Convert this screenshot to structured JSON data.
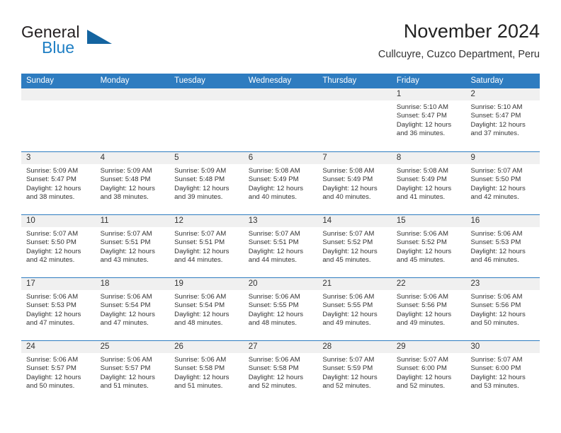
{
  "brand": {
    "word_one": "General",
    "word_two": "Blue",
    "triangle_icon": "brand-triangle-icon",
    "accent_dark": "#1464a0",
    "accent_blue": "#1f7fc4"
  },
  "header": {
    "title": "November 2024",
    "subtitle": "Cullcuyre, Cuzco Department, Peru"
  },
  "theme": {
    "header_row_bg": "#2e7cc0",
    "day_number_bg": "#f0f0f0",
    "row_divider": "#2e7cc0",
    "text": "#333333"
  },
  "weekdays": [
    "Sunday",
    "Monday",
    "Tuesday",
    "Wednesday",
    "Thursday",
    "Friday",
    "Saturday"
  ],
  "labels": {
    "sunrise": "Sunrise:",
    "sunset": "Sunset:",
    "daylight": "Daylight:"
  },
  "weeks": [
    [
      {
        "day": "",
        "sunrise": "",
        "sunset": "",
        "daylight": "",
        "empty": true
      },
      {
        "day": "",
        "sunrise": "",
        "sunset": "",
        "daylight": "",
        "empty": true
      },
      {
        "day": "",
        "sunrise": "",
        "sunset": "",
        "daylight": "",
        "empty": true
      },
      {
        "day": "",
        "sunrise": "",
        "sunset": "",
        "daylight": "",
        "empty": true
      },
      {
        "day": "",
        "sunrise": "",
        "sunset": "",
        "daylight": "",
        "empty": true
      },
      {
        "day": "1",
        "sunrise": "Sunrise: 5:10 AM",
        "sunset": "Sunset: 5:47 PM",
        "daylight": "Daylight: 12 hours and 36 minutes.",
        "empty": false
      },
      {
        "day": "2",
        "sunrise": "Sunrise: 5:10 AM",
        "sunset": "Sunset: 5:47 PM",
        "daylight": "Daylight: 12 hours and 37 minutes.",
        "empty": false
      }
    ],
    [
      {
        "day": "3",
        "sunrise": "Sunrise: 5:09 AM",
        "sunset": "Sunset: 5:47 PM",
        "daylight": "Daylight: 12 hours and 38 minutes.",
        "empty": false
      },
      {
        "day": "4",
        "sunrise": "Sunrise: 5:09 AM",
        "sunset": "Sunset: 5:48 PM",
        "daylight": "Daylight: 12 hours and 38 minutes.",
        "empty": false
      },
      {
        "day": "5",
        "sunrise": "Sunrise: 5:09 AM",
        "sunset": "Sunset: 5:48 PM",
        "daylight": "Daylight: 12 hours and 39 minutes.",
        "empty": false
      },
      {
        "day": "6",
        "sunrise": "Sunrise: 5:08 AM",
        "sunset": "Sunset: 5:49 PM",
        "daylight": "Daylight: 12 hours and 40 minutes.",
        "empty": false
      },
      {
        "day": "7",
        "sunrise": "Sunrise: 5:08 AM",
        "sunset": "Sunset: 5:49 PM",
        "daylight": "Daylight: 12 hours and 40 minutes.",
        "empty": false
      },
      {
        "day": "8",
        "sunrise": "Sunrise: 5:08 AM",
        "sunset": "Sunset: 5:49 PM",
        "daylight": "Daylight: 12 hours and 41 minutes.",
        "empty": false
      },
      {
        "day": "9",
        "sunrise": "Sunrise: 5:07 AM",
        "sunset": "Sunset: 5:50 PM",
        "daylight": "Daylight: 12 hours and 42 minutes.",
        "empty": false
      }
    ],
    [
      {
        "day": "10",
        "sunrise": "Sunrise: 5:07 AM",
        "sunset": "Sunset: 5:50 PM",
        "daylight": "Daylight: 12 hours and 42 minutes.",
        "empty": false
      },
      {
        "day": "11",
        "sunrise": "Sunrise: 5:07 AM",
        "sunset": "Sunset: 5:51 PM",
        "daylight": "Daylight: 12 hours and 43 minutes.",
        "empty": false
      },
      {
        "day": "12",
        "sunrise": "Sunrise: 5:07 AM",
        "sunset": "Sunset: 5:51 PM",
        "daylight": "Daylight: 12 hours and 44 minutes.",
        "empty": false
      },
      {
        "day": "13",
        "sunrise": "Sunrise: 5:07 AM",
        "sunset": "Sunset: 5:51 PM",
        "daylight": "Daylight: 12 hours and 44 minutes.",
        "empty": false
      },
      {
        "day": "14",
        "sunrise": "Sunrise: 5:07 AM",
        "sunset": "Sunset: 5:52 PM",
        "daylight": "Daylight: 12 hours and 45 minutes.",
        "empty": false
      },
      {
        "day": "15",
        "sunrise": "Sunrise: 5:06 AM",
        "sunset": "Sunset: 5:52 PM",
        "daylight": "Daylight: 12 hours and 45 minutes.",
        "empty": false
      },
      {
        "day": "16",
        "sunrise": "Sunrise: 5:06 AM",
        "sunset": "Sunset: 5:53 PM",
        "daylight": "Daylight: 12 hours and 46 minutes.",
        "empty": false
      }
    ],
    [
      {
        "day": "17",
        "sunrise": "Sunrise: 5:06 AM",
        "sunset": "Sunset: 5:53 PM",
        "daylight": "Daylight: 12 hours and 47 minutes.",
        "empty": false
      },
      {
        "day": "18",
        "sunrise": "Sunrise: 5:06 AM",
        "sunset": "Sunset: 5:54 PM",
        "daylight": "Daylight: 12 hours and 47 minutes.",
        "empty": false
      },
      {
        "day": "19",
        "sunrise": "Sunrise: 5:06 AM",
        "sunset": "Sunset: 5:54 PM",
        "daylight": "Daylight: 12 hours and 48 minutes.",
        "empty": false
      },
      {
        "day": "20",
        "sunrise": "Sunrise: 5:06 AM",
        "sunset": "Sunset: 5:55 PM",
        "daylight": "Daylight: 12 hours and 48 minutes.",
        "empty": false
      },
      {
        "day": "21",
        "sunrise": "Sunrise: 5:06 AM",
        "sunset": "Sunset: 5:55 PM",
        "daylight": "Daylight: 12 hours and 49 minutes.",
        "empty": false
      },
      {
        "day": "22",
        "sunrise": "Sunrise: 5:06 AM",
        "sunset": "Sunset: 5:56 PM",
        "daylight": "Daylight: 12 hours and 49 minutes.",
        "empty": false
      },
      {
        "day": "23",
        "sunrise": "Sunrise: 5:06 AM",
        "sunset": "Sunset: 5:56 PM",
        "daylight": "Daylight: 12 hours and 50 minutes.",
        "empty": false
      }
    ],
    [
      {
        "day": "24",
        "sunrise": "Sunrise: 5:06 AM",
        "sunset": "Sunset: 5:57 PM",
        "daylight": "Daylight: 12 hours and 50 minutes.",
        "empty": false
      },
      {
        "day": "25",
        "sunrise": "Sunrise: 5:06 AM",
        "sunset": "Sunset: 5:57 PM",
        "daylight": "Daylight: 12 hours and 51 minutes.",
        "empty": false
      },
      {
        "day": "26",
        "sunrise": "Sunrise: 5:06 AM",
        "sunset": "Sunset: 5:58 PM",
        "daylight": "Daylight: 12 hours and 51 minutes.",
        "empty": false
      },
      {
        "day": "27",
        "sunrise": "Sunrise: 5:06 AM",
        "sunset": "Sunset: 5:58 PM",
        "daylight": "Daylight: 12 hours and 52 minutes.",
        "empty": false
      },
      {
        "day": "28",
        "sunrise": "Sunrise: 5:07 AM",
        "sunset": "Sunset: 5:59 PM",
        "daylight": "Daylight: 12 hours and 52 minutes.",
        "empty": false
      },
      {
        "day": "29",
        "sunrise": "Sunrise: 5:07 AM",
        "sunset": "Sunset: 6:00 PM",
        "daylight": "Daylight: 12 hours and 52 minutes.",
        "empty": false
      },
      {
        "day": "30",
        "sunrise": "Sunrise: 5:07 AM",
        "sunset": "Sunset: 6:00 PM",
        "daylight": "Daylight: 12 hours and 53 minutes.",
        "empty": false
      }
    ]
  ]
}
